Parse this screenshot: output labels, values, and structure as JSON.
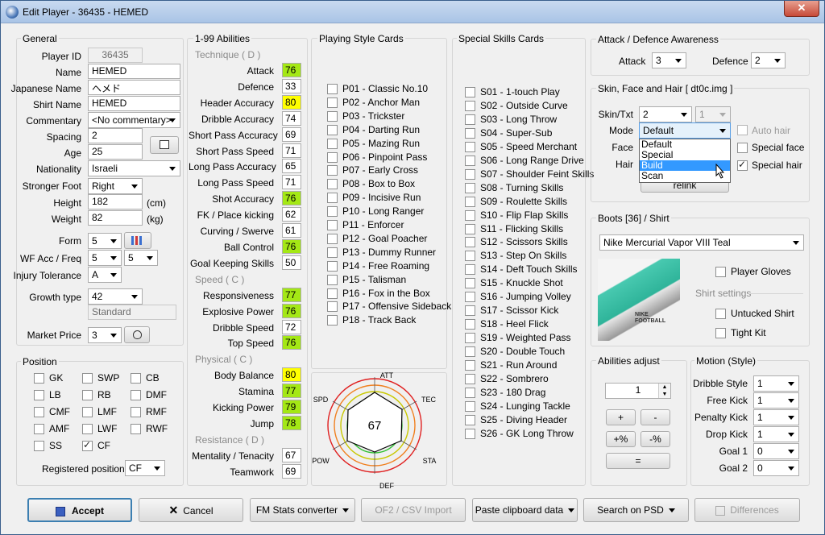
{
  "title": "Edit Player - 36435 - HEMED",
  "close": "✕",
  "general": {
    "title": "General",
    "player_id_label": "Player ID",
    "player_id": "36435",
    "name_label": "Name",
    "name": "HEMED",
    "jp_label": "Japanese Name",
    "jp": "ヘメド",
    "shirt_label": "Shirt Name",
    "shirt": "HEMED",
    "comm_label": "Commentary",
    "comm": "<No commentary>",
    "spacing_label": "Spacing",
    "spacing": "2",
    "age_label": "Age",
    "age": "25",
    "nat_label": "Nationality",
    "nat": "Israeli",
    "foot_label": "Stronger Foot",
    "foot": "Right",
    "height_label": "Height",
    "height": "182",
    "height_unit": "(cm)",
    "weight_label": "Weight",
    "weight": "82",
    "weight_unit": "(kg)",
    "form_label": "Form",
    "form": "5",
    "wf_label": "WF Acc / Freq",
    "wf_acc": "5",
    "wf_freq": "5",
    "inj_label": "Injury Tolerance",
    "inj": "A",
    "growth_label": "Growth type",
    "growth": "42",
    "growth_name": "Standard",
    "price_label": "Market Price",
    "price": "3"
  },
  "position": {
    "title": "Position",
    "items": [
      {
        "label": "GK",
        "on": false
      },
      {
        "label": "SWP",
        "on": false
      },
      {
        "label": "CB",
        "on": false
      },
      {
        "label": "LB",
        "on": false
      },
      {
        "label": "RB",
        "on": false
      },
      {
        "label": "DMF",
        "on": false
      },
      {
        "label": "CMF",
        "on": false
      },
      {
        "label": "LMF",
        "on": false
      },
      {
        "label": "RMF",
        "on": false
      },
      {
        "label": "AMF",
        "on": false
      },
      {
        "label": "LWF",
        "on": false
      },
      {
        "label": "RWF",
        "on": false
      },
      {
        "label": "SS",
        "on": false
      },
      {
        "label": "CF",
        "on": true
      }
    ],
    "reg_label": "Registered position",
    "reg": "CF"
  },
  "abilities": {
    "title": "1-99 Abilities",
    "groups": [
      {
        "name": "Technique ( D )",
        "items": [
          {
            "label": "Attack",
            "value": "76",
            "color": "g"
          },
          {
            "label": "Defence",
            "value": "33",
            "color": ""
          },
          {
            "label": "Header Accuracy",
            "value": "80",
            "color": "y"
          },
          {
            "label": "Dribble Accuracy",
            "value": "74",
            "color": ""
          },
          {
            "label": "Short Pass Accuracy",
            "value": "69",
            "color": ""
          },
          {
            "label": "Short Pass Speed",
            "value": "71",
            "color": ""
          },
          {
            "label": "Long Pass Accuracy",
            "value": "65",
            "color": ""
          },
          {
            "label": "Long Pass Speed",
            "value": "71",
            "color": ""
          },
          {
            "label": "Shot Accuracy",
            "value": "76",
            "color": "g"
          },
          {
            "label": "FK / Place kicking",
            "value": "62",
            "color": ""
          },
          {
            "label": "Curving / Swerve",
            "value": "61",
            "color": ""
          },
          {
            "label": "Ball Control",
            "value": "76",
            "color": "g"
          },
          {
            "label": "Goal Keeping Skills",
            "value": "50",
            "color": ""
          }
        ]
      },
      {
        "name": "Speed ( C )",
        "items": [
          {
            "label": "Responsiveness",
            "value": "77",
            "color": "g"
          },
          {
            "label": "Explosive Power",
            "value": "76",
            "color": "g"
          },
          {
            "label": "Dribble Speed",
            "value": "72",
            "color": ""
          },
          {
            "label": "Top Speed",
            "value": "76",
            "color": "g"
          }
        ]
      },
      {
        "name": "Physical ( C )",
        "items": [
          {
            "label": "Body Balance",
            "value": "80",
            "color": "y"
          },
          {
            "label": "Stamina",
            "value": "77",
            "color": "g"
          },
          {
            "label": "Kicking Power",
            "value": "79",
            "color": "g"
          },
          {
            "label": "Jump",
            "value": "78",
            "color": "g"
          }
        ]
      },
      {
        "name": "Resistance ( D )",
        "items": [
          {
            "label": "Mentality / Tenacity",
            "value": "67",
            "color": ""
          },
          {
            "label": "Teamwork",
            "value": "69",
            "color": ""
          }
        ]
      }
    ]
  },
  "playing_style": {
    "title": "Playing Style Cards",
    "items": [
      "P01 - Classic No.10",
      "P02 - Anchor Man",
      "P03 - Trickster",
      "P04 - Darting Run",
      "P05 - Mazing Run",
      "P06 - Pinpoint Pass",
      "P07 - Early Cross",
      "P08 - Box to Box",
      "P09 - Incisive Run",
      "P10 - Long Ranger",
      "P11 - Enforcer",
      "P12 - Goal Poacher",
      "P13 - Dummy Runner",
      "P14 - Free Roaming",
      "P15 - Talisman",
      "P16 - Fox in the Box",
      "P17 - Offensive Sideback",
      "P18 - Track Back"
    ]
  },
  "radar": {
    "center": "67",
    "labels": [
      "ATT",
      "TEC",
      "STA",
      "DEF",
      "POW",
      "SPD"
    ]
  },
  "special": {
    "title": "Special Skills Cards",
    "items": [
      "S01 - 1-touch Play",
      "S02 - Outside Curve",
      "S03 - Long Throw",
      "S04 - Super-Sub",
      "S05 - Speed Merchant",
      "S06 - Long Range Drive",
      "S07 - Shoulder Feint Skills",
      "S08 - Turning Skills",
      "S09 - Roulette Skills",
      "S10 - Flip Flap Skills",
      "S11 - Flicking Skills",
      "S12 - Scissors Skills",
      "S13 - Step On Skills",
      "S14 - Deft Touch Skills",
      "S15 - Knuckle Shot",
      "S16 - Jumping Volley",
      "S17 - Scissor Kick",
      "S18 - Heel Flick",
      "S19 - Weighted Pass",
      "S20 - Double Touch",
      "S21 - Run Around",
      "S22 - Sombrero",
      "S23 - 180 Drag",
      "S24 - Lunging Tackle",
      "S25 - Diving Header",
      "S26 - GK Long Throw"
    ]
  },
  "awareness": {
    "title": "Attack / Defence Awareness",
    "attack_label": "Attack",
    "attack": "3",
    "defence_label": "Defence",
    "defence": "2"
  },
  "skin": {
    "title": "Skin, Face and Hair [ dt0c.img ]",
    "skin_label": "Skin/Txt",
    "skin": "2",
    "txt": "1",
    "mode_label": "Mode",
    "mode": "Default",
    "face_label": "Face",
    "hair_label": "Hair",
    "options": [
      "Default",
      "Special",
      "Build",
      "Scan"
    ],
    "highlight": 2,
    "relink": "relink",
    "auto_hair": "Auto hair",
    "special_face": "Special face",
    "special_hair": "Special hair"
  },
  "boots": {
    "title": "Boots [36] / Shirt",
    "boot": "Nike Mercurial Vapor VIII Teal",
    "gloves": "Player Gloves",
    "shirt_settings": "Shirt settings",
    "untucked": "Untucked Shirt",
    "tight": "Tight Kit",
    "boot_text": "NIKE FOOTBALL"
  },
  "adjust": {
    "title": "Abilities adjust",
    "value": "1",
    "plus": "+",
    "minus": "-",
    "plus_pct": "+%",
    "minus_pct": "-%",
    "eq": "="
  },
  "motion": {
    "title": "Motion (Style)",
    "items": [
      {
        "label": "Dribble Style",
        "value": "1"
      },
      {
        "label": "Free Kick",
        "value": "1"
      },
      {
        "label": "Penalty Kick",
        "value": "1"
      },
      {
        "label": "Drop Kick",
        "value": "1"
      },
      {
        "label": "Goal 1",
        "value": "0"
      },
      {
        "label": "Goal 2",
        "value": "0"
      }
    ]
  },
  "buttons": {
    "accept": "Accept",
    "cancel": "Cancel",
    "fm": "FM Stats converter",
    "of2": "OF2 / CSV Import",
    "paste": "Paste clipboard data",
    "search": "Search on PSD",
    "diff": "Differences"
  }
}
